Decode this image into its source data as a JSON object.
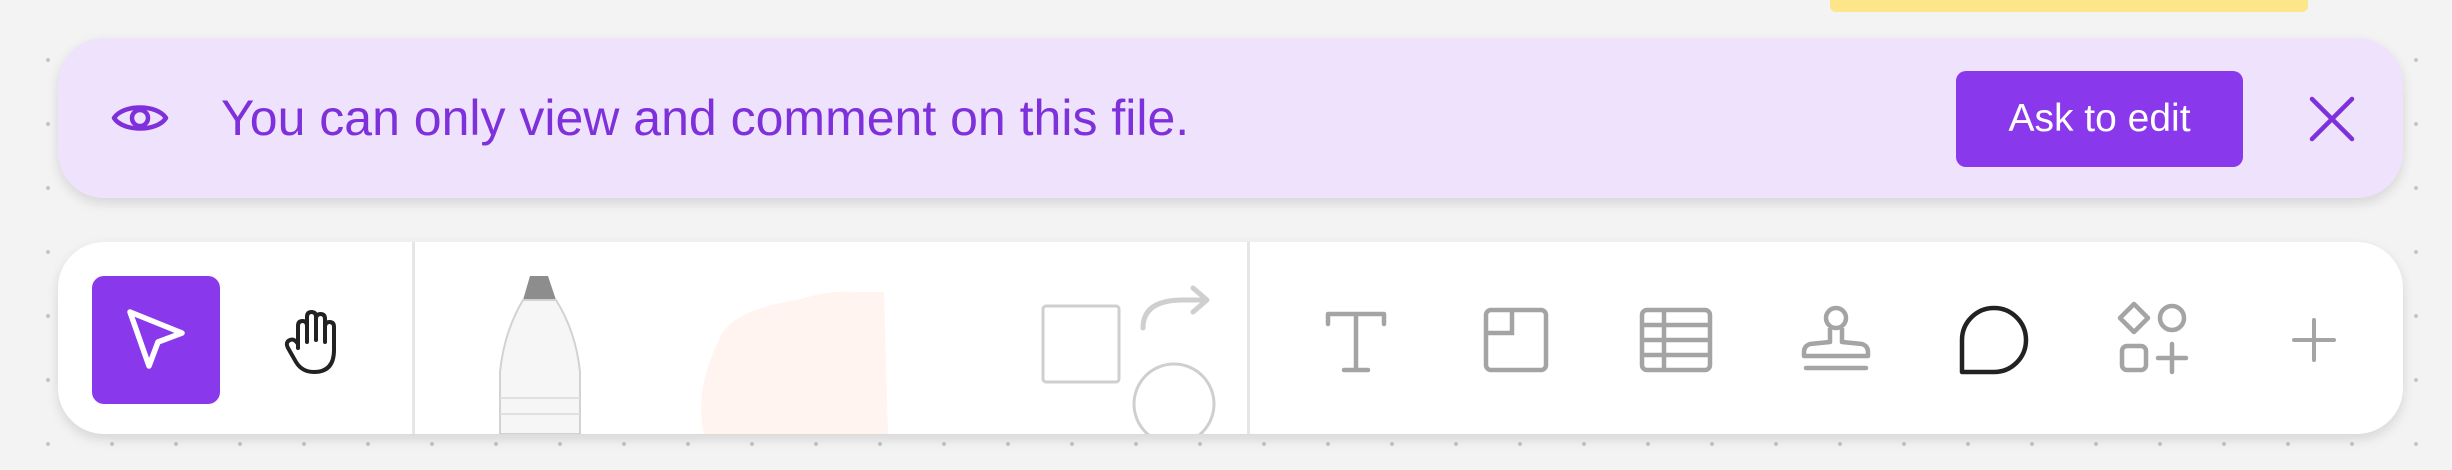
{
  "banner": {
    "icon": "eye-icon",
    "message": "You can only view and comment on this file.",
    "ask_button_label": "Ask to edit",
    "close_icon": "close-icon",
    "background": "#efe2fc",
    "accent": "#8a38ec",
    "text_color": "#7e30db"
  },
  "toolbar": {
    "selected_tool": "select",
    "tools": [
      {
        "name": "select",
        "icon": "cursor-arrow-icon"
      },
      {
        "name": "hand",
        "icon": "hand-icon"
      },
      {
        "name": "pen",
        "icon": "pen-icon"
      },
      {
        "name": "marker",
        "icon": "marker-icon"
      },
      {
        "name": "shapes",
        "icon": "shapes-icon"
      },
      {
        "name": "text",
        "icon": "text-icon"
      },
      {
        "name": "section",
        "icon": "section-icon"
      },
      {
        "name": "table",
        "icon": "table-icon"
      },
      {
        "name": "stamp",
        "icon": "stamp-icon"
      },
      {
        "name": "comment",
        "icon": "comment-icon"
      },
      {
        "name": "widgets",
        "icon": "widgets-icon"
      },
      {
        "name": "more",
        "icon": "plus-icon"
      }
    ]
  },
  "canvas": {
    "sticky_note_color": "#fde68a"
  }
}
